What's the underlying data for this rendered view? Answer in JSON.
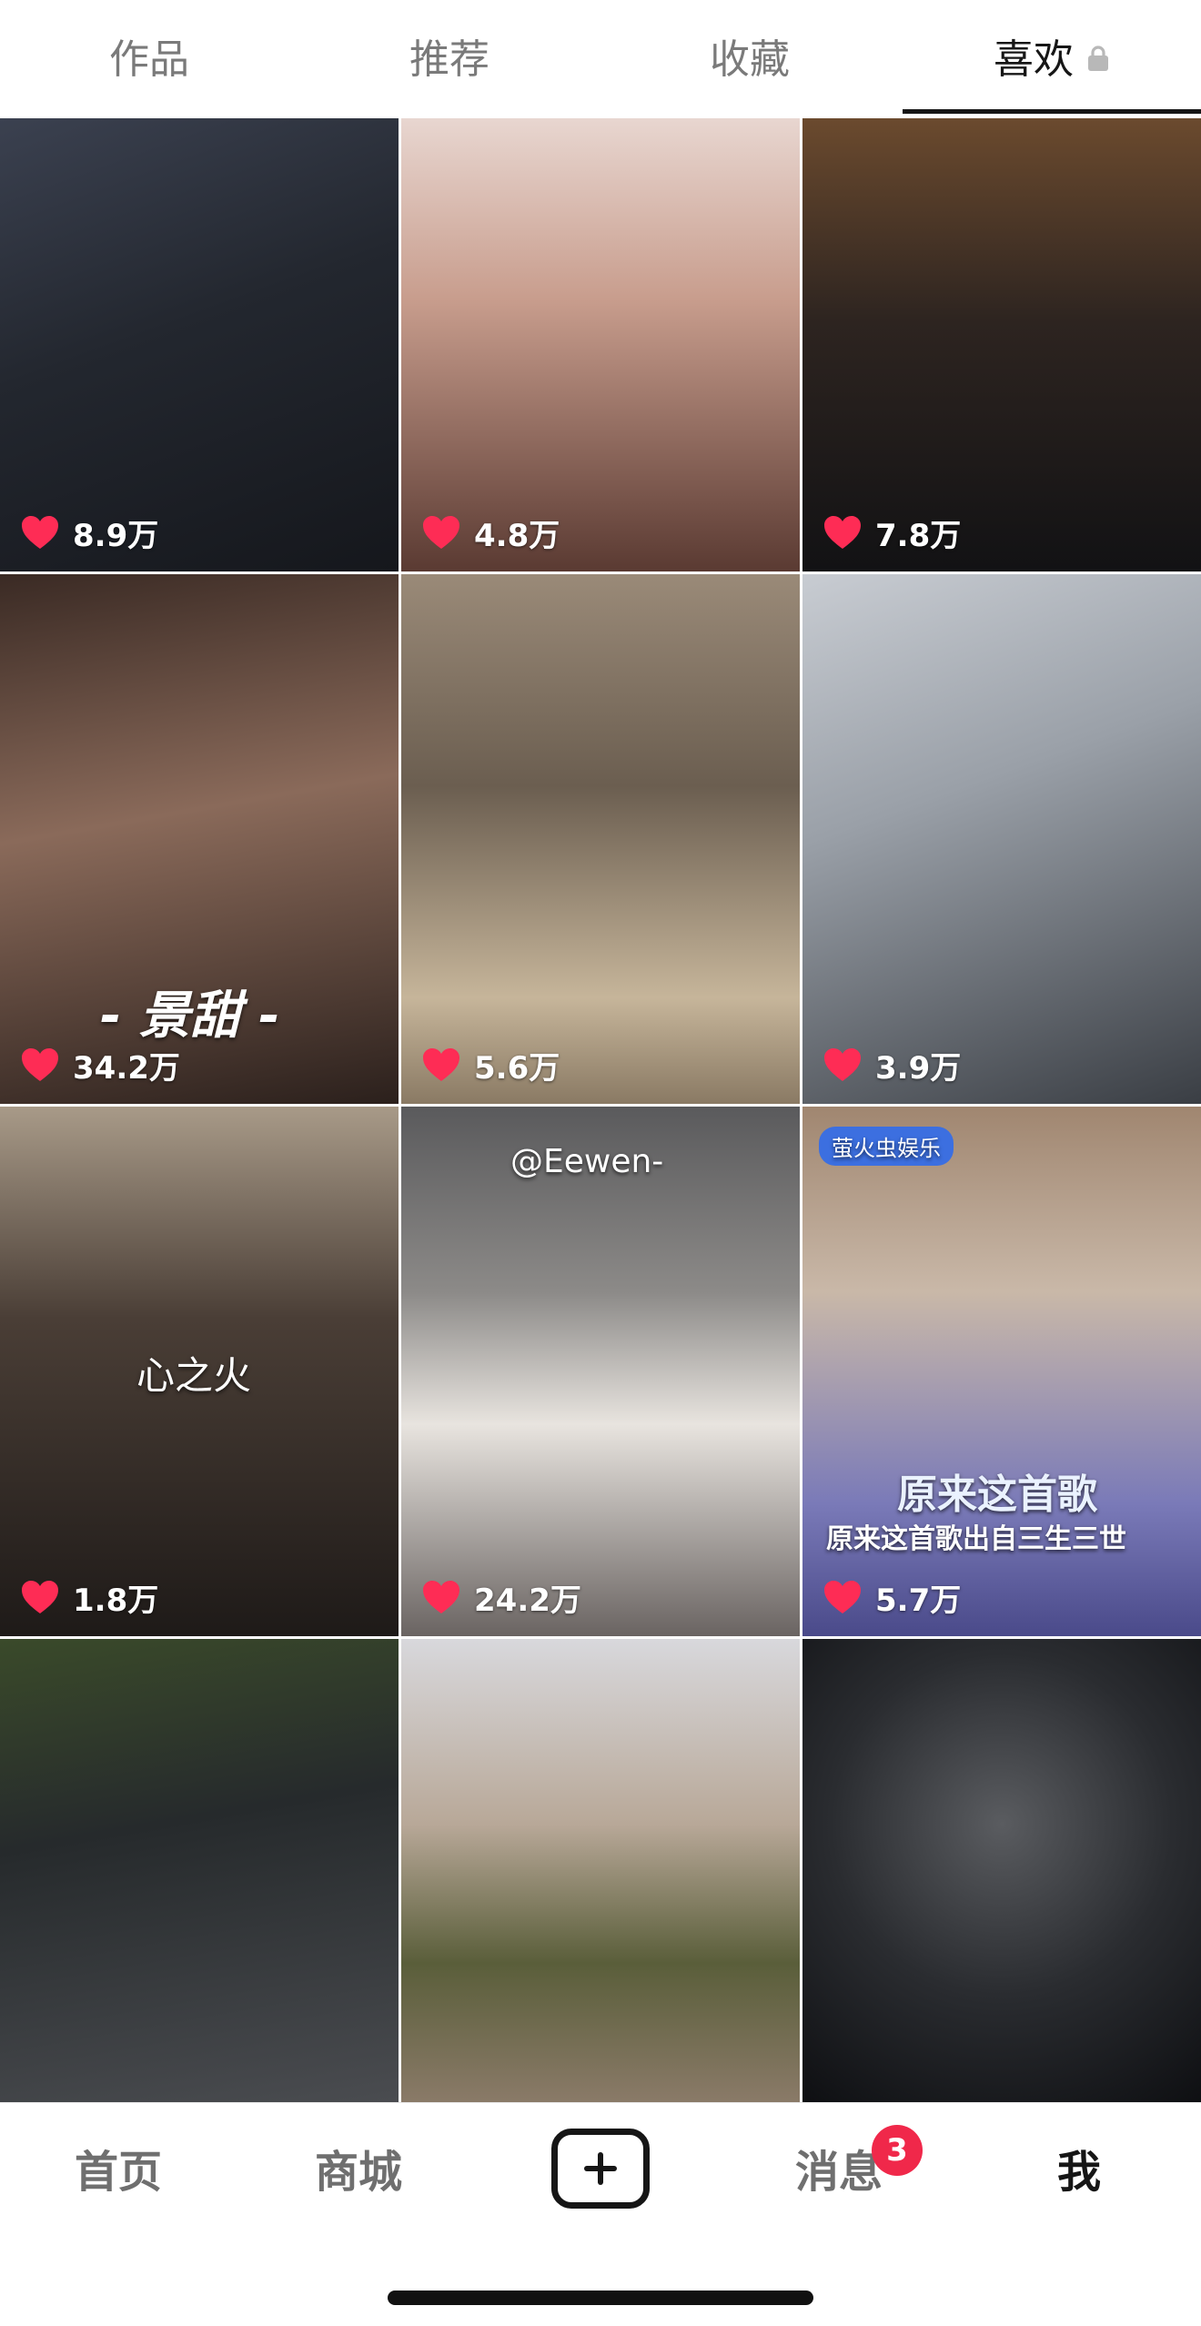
{
  "tabs": [
    {
      "label": "作品"
    },
    {
      "label": "推荐"
    },
    {
      "label": "收藏"
    },
    {
      "label": "喜欢"
    }
  ],
  "active_tab": "喜欢",
  "grid": {
    "items": [
      {
        "likes": "8.9万"
      },
      {
        "likes": "4.8万"
      },
      {
        "likes": "7.8万"
      },
      {
        "likes": "34.2万",
        "caption": "- 景甜 -"
      },
      {
        "likes": "5.6万"
      },
      {
        "likes": "3.9万"
      },
      {
        "likes": "1.8万",
        "caption": "心之火"
      },
      {
        "likes": "24.2万",
        "caption": "@Eewen-"
      },
      {
        "likes": "5.7万",
        "caption": "原来这首歌",
        "subcaption": "原来这首歌出自三生三世",
        "tag": "萤火虫娱乐"
      },
      {
        "likes": ""
      },
      {
        "likes": ""
      },
      {
        "likes": ""
      }
    ]
  },
  "bottom_nav": {
    "home": "首页",
    "mall": "商城",
    "messages": "消息",
    "messages_badge": "3",
    "me": "我"
  },
  "colors": {
    "heart": "#fe2c55",
    "badge": "#f0284a",
    "text_active": "#161616",
    "text_inactive": "#7a7a7a"
  },
  "icons": [
    "lock-icon",
    "heart-icon",
    "plus-icon"
  ]
}
